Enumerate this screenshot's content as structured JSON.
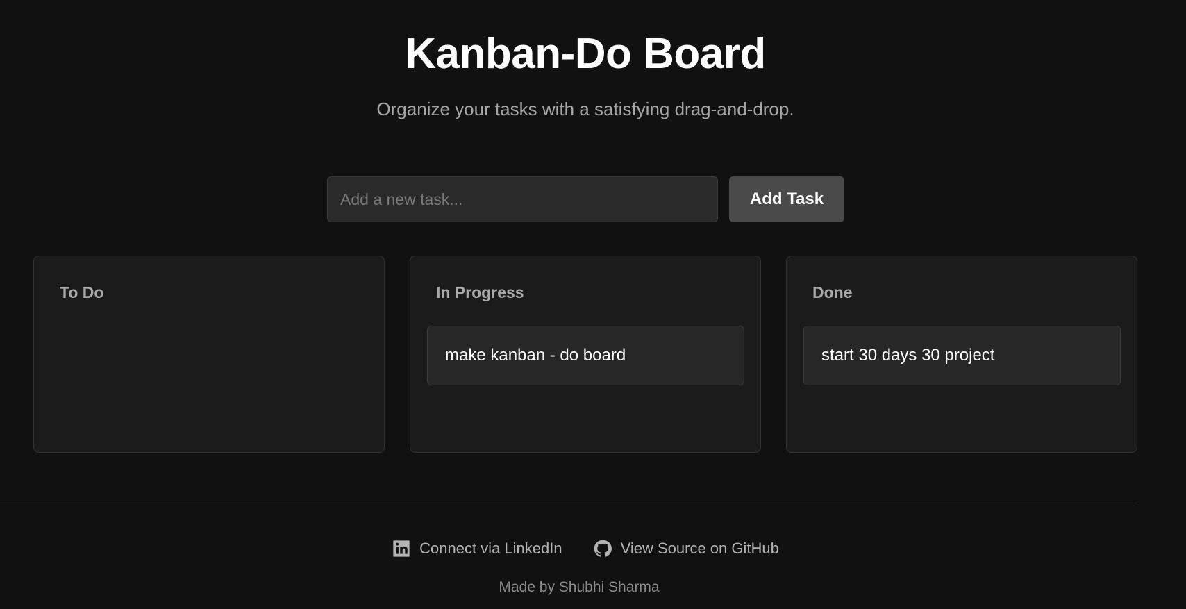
{
  "header": {
    "title": "Kanban-Do Board",
    "subtitle": "Organize your tasks with a satisfying drag-and-drop."
  },
  "form": {
    "input_placeholder": "Add a new task...",
    "input_value": "",
    "add_button_label": "Add Task"
  },
  "columns": [
    {
      "title": "To Do",
      "tasks": []
    },
    {
      "title": "In Progress",
      "tasks": [
        "make kanban - do board"
      ]
    },
    {
      "title": "Done",
      "tasks": [
        "start 30 days 30 project"
      ]
    }
  ],
  "footer": {
    "linkedin_label": "Connect via LinkedIn",
    "linkedin_icon": "linkedin-icon",
    "github_label": "View Source on GitHub",
    "github_icon": "github-icon",
    "credit": "Made by Shubhi Sharma"
  },
  "colors": {
    "background": "#111111",
    "column_bg": "#1b1b1b",
    "card_bg": "#272727",
    "button_bg": "#4a4a4a",
    "muted_text": "#a6a6a6"
  }
}
